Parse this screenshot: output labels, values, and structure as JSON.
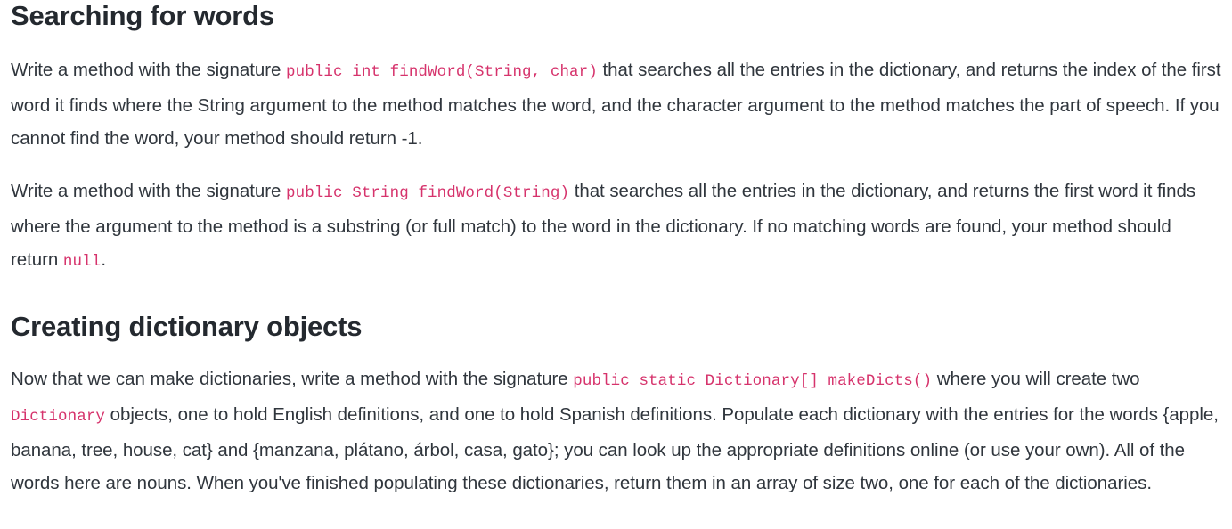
{
  "document": {
    "sections": [
      {
        "id": "searching-for-words",
        "heading": "Searching for words",
        "paragraphs": [
          {
            "id": "find-word-index",
            "parts": [
              {
                "type": "text",
                "value": "Write a method with the signature "
              },
              {
                "type": "code",
                "value": "public int findWord(String, char)"
              },
              {
                "type": "text",
                "value": " that searches all the entries in the dictionary, and returns the index of the first word it finds where the String argument to the method matches the word, and the character argument to the method matches the part of speech. If you cannot find the word, your method should return -1."
              }
            ]
          },
          {
            "id": "find-word-substring",
            "parts": [
              {
                "type": "text",
                "value": "Write a method with the signature "
              },
              {
                "type": "code",
                "value": "public String findWord(String)"
              },
              {
                "type": "text",
                "value": " that searches all the entries in the dictionary, and returns the first word it finds where the argument to the method is a substring (or full match) to the word in the dictionary. If no matching words are found, your method should return "
              },
              {
                "type": "code",
                "value": "null"
              },
              {
                "type": "text",
                "value": "."
              }
            ]
          }
        ]
      },
      {
        "id": "creating-dictionary-objects",
        "heading": "Creating dictionary objects",
        "paragraphs": [
          {
            "id": "make-dicts",
            "parts": [
              {
                "type": "text",
                "value": "Now that we can make dictionaries, write a method with the signature "
              },
              {
                "type": "code",
                "value": "public static Dictionary[] makeDicts()"
              },
              {
                "type": "text",
                "value": " where you will create two "
              },
              {
                "type": "code",
                "value": "Dictionary"
              },
              {
                "type": "text",
                "value": " objects, one to hold English definitions, and one to hold Spanish definitions. Populate each dictionary with the entries for the words {apple, banana, tree, house, cat} and {manzana, plátano, árbol, casa, gato}; you can look up the appropriate definitions online (or use your own). All of the words here are nouns. When you've finished populating these dictionaries, return them in an array of size two, one for each of the dictionaries."
              }
            ]
          }
        ]
      }
    ],
    "colors": {
      "heading": "#24292f",
      "body": "#30363d",
      "code": "#d6336c",
      "background": "#ffffff"
    }
  }
}
